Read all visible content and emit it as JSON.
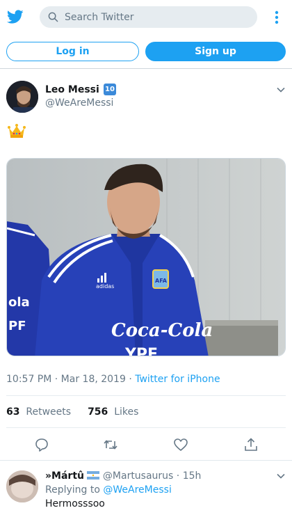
{
  "header": {
    "search_placeholder": "Search Twitter",
    "login_label": "Log in",
    "signup_label": "Sign up"
  },
  "tweet": {
    "author_name": "Leo Messi",
    "author_badge": "10",
    "author_handle": "@WeAreMessi",
    "content_emoji": "crown",
    "photo_subject_alt": "Player in blue Argentina training jacket",
    "photo_jacket_sponsor": "Coca-Cola",
    "photo_jacket_sponsor_alt": "YPF",
    "timestamp": "10:57 PM · Mar 18, 2019 · ",
    "source": "Twitter for iPhone",
    "retweets_count": "63",
    "retweets_label": "Retweets",
    "likes_count": "756",
    "likes_label": "Likes"
  },
  "reply": {
    "name": "»Mártû",
    "handle": "@Martusaurus",
    "time": " · 15h",
    "replying_prefix": "Replying to ",
    "replying_handle": "@WeAreMessi",
    "text": "Hermosssoo"
  },
  "colors": {
    "accent": "#1da1f2",
    "muted": "#657786",
    "text": "#14171a"
  },
  "icons": [
    "twitter-bird-icon",
    "search-icon",
    "more-vertical-icon",
    "chevron-down-icon",
    "crown-emoji",
    "reply-icon",
    "retweet-icon",
    "like-icon",
    "share-icon",
    "argentina-flag-icon"
  ]
}
